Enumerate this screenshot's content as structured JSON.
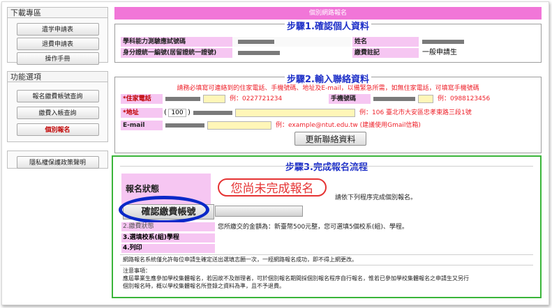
{
  "sidebar": {
    "downloads_title": "下載專區",
    "downloads": [
      "遺学申請表",
      "退費申請表",
      "操作手冊"
    ],
    "functions_title": "功能選項",
    "functions": [
      "報名繳費帳號查詢",
      "繳費入帳查詢",
      "個別報名"
    ],
    "privacy": "隱私權保護政策聲明"
  },
  "main": {
    "header": "個別網路報名",
    "step1": {
      "title": "步驟1.確認個人資料",
      "exam_id_label": "學科能力測驗應試號碼",
      "name_label": "姓名",
      "id_label": "身分證統一編號(居留證統一證號)",
      "fee_label": "繳費註記",
      "fee_value": "一般申請生"
    },
    "step2": {
      "title": "步驟2.輸入聯絡資料",
      "notice": "請務必填寫可連絡到的住家電話、手機號碼、地址及E-mail，以備緊急所需，如無住家電話，可填寫手機號碼",
      "phone_label": "*住家電話",
      "phone_example": "例：0227721234",
      "mobile_label": "手機號碼",
      "mobile_example": "例：0988123456",
      "address_label": "*地址",
      "zip_value": "100",
      "address_example": "例：106 臺北市大安區忠孝東路三段1號",
      "email_label": "E-mail",
      "email_example": "例：example@ntut.edu.tw (建議使用Gmail信箱)",
      "update_button": "更新聯絡資料"
    },
    "step3": {
      "title": "步驟3.完成報名流程",
      "status_label": "報名狀態",
      "status_text": "您尚未完成報名",
      "status_hint": "請依下列程序完成個別報名。",
      "confirm_button": "確認繳費帳號",
      "step2_label": "2.繳費狀態",
      "step2_text": "您所繳交的金額為：新臺幣500元整，您可選填5個校系(組)、學程。",
      "step3_label": "3.選填校系(組)學程",
      "step4_label": "4.列印",
      "rule_text": "網路報名系統僅允許每位申請生確定送出選填志願一次，一經網路報名成功，即不得上網更改。",
      "notes_title": "注意事項：",
      "notes_line1": "應屆畢業生應參加學校集體報名，若因故不及辦理者，可於個別報名期間採個別報名程序自行報名，惟若已參加學校集體報名之申請生又另行",
      "notes_line2": "個別報名時，概以學校集體報名所登錄之資料為準，且不予退費。"
    }
  },
  "colors": {
    "accent_pink": "#f176d8",
    "label_pink": "#f6c6f2",
    "step_blue": "#1e30c8",
    "warning_red": "#ee1f28",
    "green_outline": "#3ab53a",
    "highlight_blue": "#0a28c8"
  }
}
